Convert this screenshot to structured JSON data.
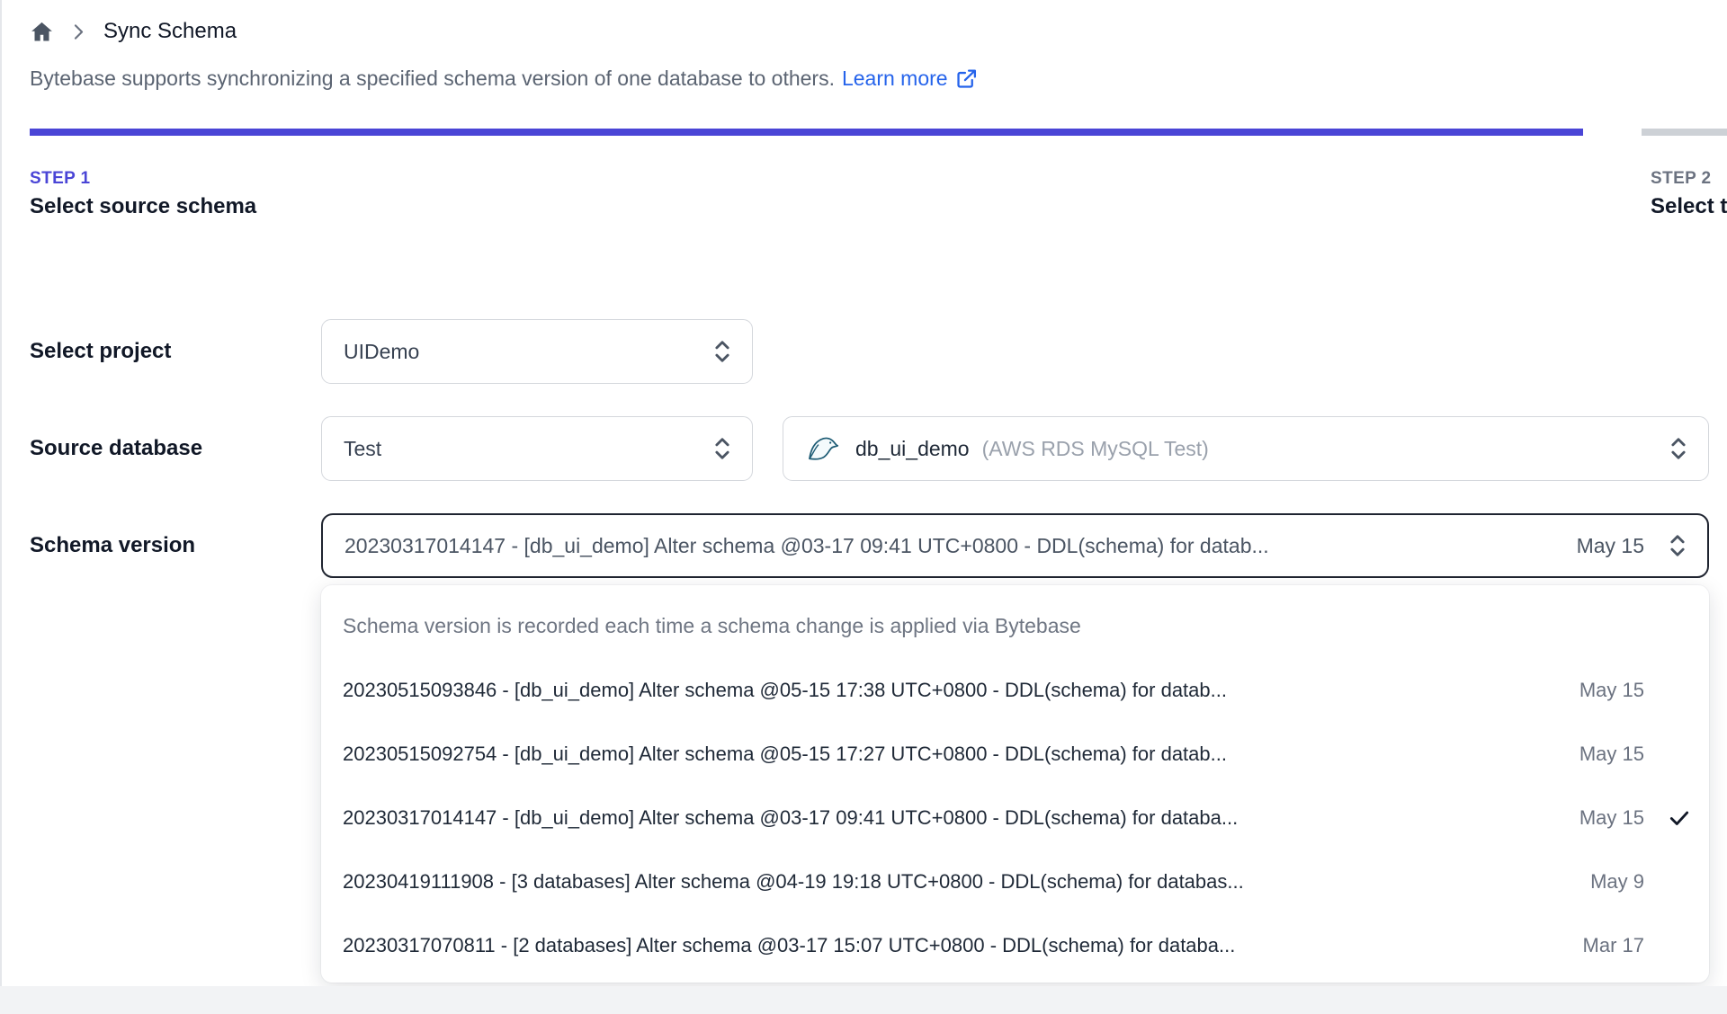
{
  "breadcrumb": {
    "title": "Sync Schema"
  },
  "description": {
    "text": "Bytebase supports synchronizing a specified schema version of one database to others.",
    "link_label": "Learn more"
  },
  "steps": [
    {
      "step": "STEP 1",
      "title": "Select source schema",
      "state": "active"
    },
    {
      "step": "STEP 2",
      "title": "Select t",
      "state": "upcoming"
    }
  ],
  "form": {
    "project": {
      "label": "Select project",
      "value": "UIDemo"
    },
    "source_database": {
      "label": "Source database",
      "environment_value": "Test",
      "database_value": "db_ui_demo",
      "database_detail": "(AWS RDS MySQL Test)"
    },
    "schema_version": {
      "label": "Schema version",
      "value": "20230317014147 - [db_ui_demo] Alter schema @03-17 09:41 UTC+0800 - DDL(schema) for datab...",
      "date": "May 15"
    }
  },
  "dropdown": {
    "hint": "Schema version is recorded each time a schema change is applied via Bytebase",
    "options": [
      {
        "text": "20230515093846 - [db_ui_demo] Alter schema @05-15 17:38 UTC+0800 - DDL(schema) for datab...",
        "date": "May 15",
        "selected": false
      },
      {
        "text": "20230515092754 - [db_ui_demo] Alter schema @05-15 17:27 UTC+0800 - DDL(schema) for datab...",
        "date": "May 15",
        "selected": false
      },
      {
        "text": "20230317014147 - [db_ui_demo] Alter schema @03-17 09:41 UTC+0800 - DDL(schema) for databa...",
        "date": "May 15",
        "selected": true
      },
      {
        "text": "20230419111908 - [3 databases] Alter schema @04-19 19:18 UTC+0800 - DDL(schema) for databas...",
        "date": "May 9",
        "selected": false
      },
      {
        "text": "20230317070811 - [2 databases] Alter schema @03-17 15:07 UTC+0800 - DDL(schema) for databa...",
        "date": "Mar 17",
        "selected": false
      }
    ]
  },
  "icons": {
    "home": "home-icon",
    "breadcrumb_chevron": "chevron-right-icon",
    "external_link": "external-link-icon",
    "select_updown": "chevron-up-down-icon",
    "mysql": "mysql-dolphin-icon",
    "check": "check-icon"
  },
  "colors": {
    "accent_indigo": "#4a45d6",
    "link_blue": "#2563eb",
    "progress_rest": "#cdd1d6",
    "focus_border": "#1f2430"
  }
}
